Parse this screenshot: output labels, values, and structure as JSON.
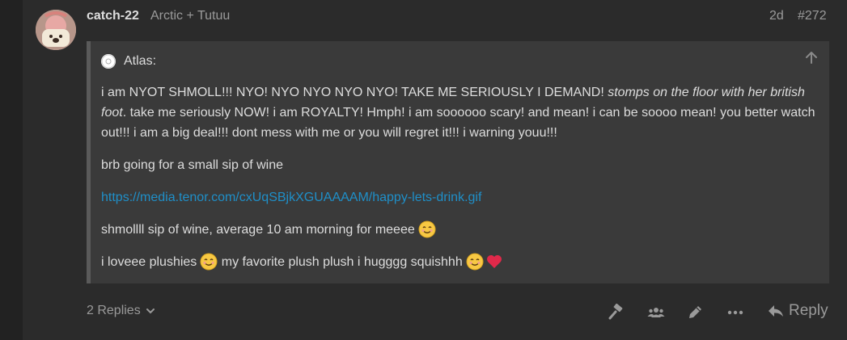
{
  "post": {
    "username": "catch-22",
    "full_name": "Arctic + Tutuu",
    "age": "2d",
    "post_number": "#272"
  },
  "quote": {
    "author": "Atlas:",
    "p1_text": "i am NYOT SHMOLL!!! NYO! NYO NYO NYO NYO! TAKE ME SERIOUSLY I DEMAND! ",
    "p1_italic": "stomps on the floor with her british foot",
    "p1_rest": ". take me seriously NOW! i am ROYALTY! Hmph! i am soooooo scary! and mean! i can be soooo mean! you better watch out!!! i am a big deal!!! dont mess with me or you will regret it!!! i warning youu!!!",
    "p2": "brb going for a small sip of wine",
    "link": "https://media.tenor.com/cxUqSBjkXGUAAAAM/happy-lets-drink.gif",
    "p4": "shmollll sip of wine, average 10 am morning for meeee",
    "p5_a": "i loveee plushies",
    "p5_b": "my favorite plush plush i hugggg squishhh"
  },
  "controls": {
    "replies_label": "2 Replies",
    "reply_label": "Reply"
  },
  "icons": {
    "expand": "arrow-up-icon",
    "flag": "gavel-icon",
    "users": "users-icon",
    "edit": "pencil-icon",
    "more": "more-dots-icon",
    "reply": "reply-arrow-icon",
    "emoji_smile": "smiling-face-icon",
    "emoji_heart": "red-heart-icon"
  },
  "colors": {
    "link": "#1f8fc8",
    "heart": "#e0294a",
    "emoji": "#f7c843"
  }
}
